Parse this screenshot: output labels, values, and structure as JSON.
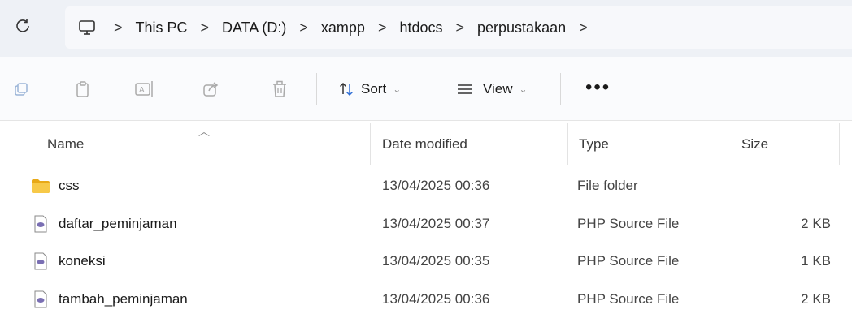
{
  "address_bar": {
    "breadcrumbs": [
      "This PC",
      "DATA (D:)",
      "xampp",
      "htdocs",
      "perpustakaan"
    ],
    "separator": ">",
    "refresh_icon": "refresh-icon",
    "root_icon": "computer-icon"
  },
  "toolbar": {
    "icons": [
      "new-item-icon",
      "copy-icon",
      "paste-icon",
      "rename-icon",
      "share-icon",
      "delete-icon"
    ],
    "sort_label": "Sort",
    "view_label": "View",
    "more_label": "•••"
  },
  "columns": {
    "name": "Name",
    "date_modified": "Date modified",
    "type": "Type",
    "size": "Size"
  },
  "files": [
    {
      "name": "css",
      "date": "13/04/2025 00:36",
      "type": "File folder",
      "size": "",
      "icon": "folder-icon"
    },
    {
      "name": "daftar_peminjaman",
      "date": "13/04/2025 00:37",
      "type": "PHP Source File",
      "size": "2 KB",
      "icon": "php-file-icon"
    },
    {
      "name": "koneksi",
      "date": "13/04/2025 00:35",
      "type": "PHP Source File",
      "size": "1 KB",
      "icon": "php-file-icon"
    },
    {
      "name": "tambah_peminjaman",
      "date": "13/04/2025 00:36",
      "type": "PHP Source File",
      "size": "2 KB",
      "icon": "php-file-icon"
    }
  ],
  "colors": {
    "address_bg": "#eef1f6",
    "folder": "#f4c430",
    "php_icon": "#7a6fb3"
  }
}
